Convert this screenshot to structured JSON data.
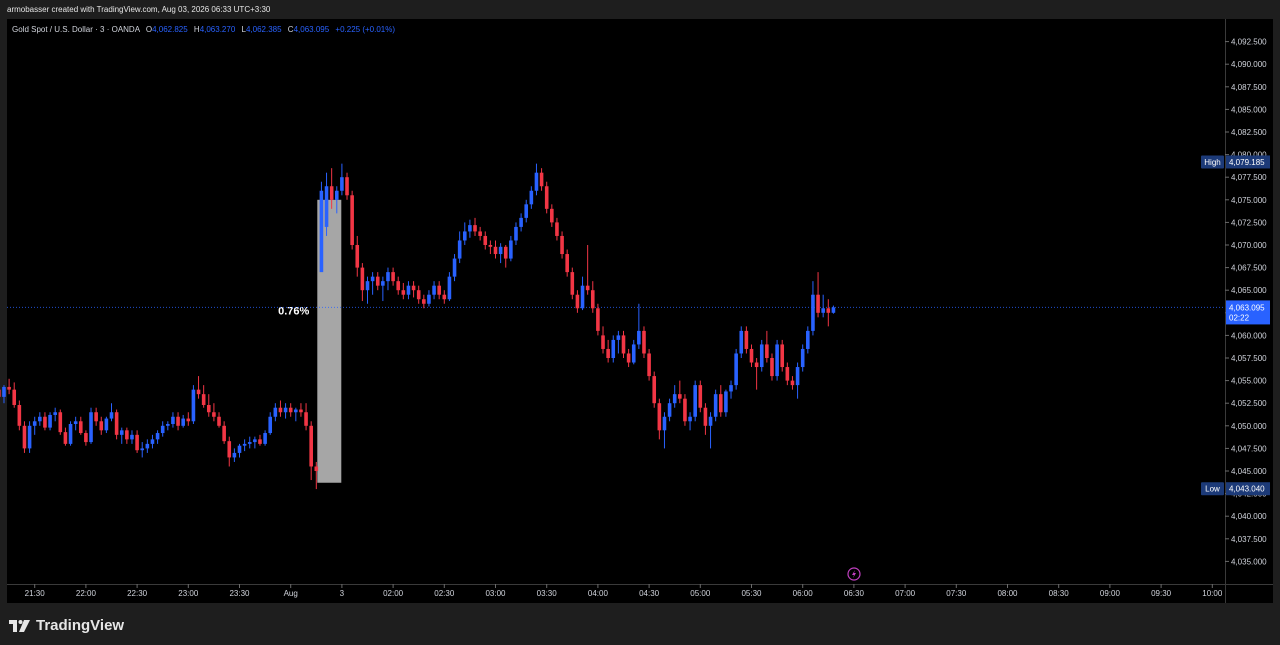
{
  "header": {
    "credit": "armobasser created with TradingView.com, Aug 03, 2026 06:33 UTC+3:30"
  },
  "legend": {
    "symbol": "Gold Spot / U.S. Dollar · 3 · OANDA",
    "o_label": "O",
    "o_value": "4,062.825",
    "h_label": "H",
    "h_value": "4,063.270",
    "l_label": "L",
    "l_value": "4,062.385",
    "c_label": "C",
    "c_value": "4,063.095",
    "change": "+0.225 (+0.01%)"
  },
  "measure": {
    "label": "0.76%"
  },
  "price_labels": {
    "high_tag": "High",
    "high_value": "4,079.185",
    "low_tag": "Low",
    "low_value": "4,043.040",
    "current_value": "4,063.095",
    "countdown": "02:22"
  },
  "footer": {
    "brand": "TradingView"
  },
  "colors": {
    "up": "#2962ff",
    "down": "#f23645",
    "background": "#000000",
    "measure_box": "#a6a6a6",
    "current_line": "#2962ff"
  },
  "icons": {
    "logo": "tradingview-logo-icon",
    "alert": "lightning-icon"
  },
  "chart_data": {
    "type": "candlestick",
    "title": "Gold Spot / U.S. Dollar · 3 · OANDA",
    "ylim": [
      4032.5,
      4095
    ],
    "y_ticks": [
      4092.5,
      4090,
      4087.5,
      4085,
      4082.5,
      4080,
      4077.5,
      4075,
      4072.5,
      4070,
      4067.5,
      4065,
      4062.5,
      4060,
      4057.5,
      4055,
      4052.5,
      4050,
      4047.5,
      4045,
      4042.5,
      4040,
      4037.5,
      4035
    ],
    "y_tick_labels": [
      "4,092.500",
      "4,090.000",
      "4,087.500",
      "4,085.000",
      "4,082.500",
      "4,080.000",
      "4,077.500",
      "4,075.000",
      "4,072.500",
      "4,070.000",
      "4,067.500",
      "4,065.000",
      "4,062.500",
      "4,060.000",
      "4,057.500",
      "4,055.000",
      "4,052.500",
      "4,050.000",
      "4,047.500",
      "4,045.000",
      "4,042.500",
      "4,040.000",
      "4,037.500",
      "4,035.000"
    ],
    "x_tick_labels": [
      "21:30",
      "22:00",
      "22:30",
      "23:00",
      "23:30",
      "Aug",
      "3",
      "02:00",
      "02:30",
      "03:00",
      "03:30",
      "04:00",
      "04:30",
      "05:00",
      "05:30",
      "06:00",
      "06:30",
      "07:00",
      "07:30",
      "08:00",
      "08:30",
      "09:00",
      "09:30",
      "10:00"
    ],
    "x_tick_index": [
      10,
      20,
      30,
      40,
      50,
      60,
      70,
      80,
      90,
      100,
      110,
      120,
      130,
      140,
      150,
      160,
      170,
      180,
      190,
      200,
      210,
      220,
      230,
      240
    ],
    "measure_range": {
      "from": 4043.7,
      "to": 4075
    },
    "current_price": 4063.095,
    "high": 4079.185,
    "low": 4043.04,
    "candles": [
      [
        4052.5,
        4054.0,
        4050.5,
        4053.5
      ],
      [
        4053.5,
        4055.0,
        4052.5,
        4054.5
      ],
      [
        4054.5,
        4055.2,
        4053.0,
        4054.0
      ],
      [
        4054.0,
        4055.0,
        4052.8,
        4053.2
      ],
      [
        4053.2,
        4054.5,
        4052.5,
        4054.3
      ],
      [
        4054.3,
        4055.2,
        4053.5,
        4054.0
      ],
      [
        4054.0,
        4054.8,
        4052.0,
        4052.3
      ],
      [
        4052.3,
        4052.8,
        4049.5,
        4050.0
      ],
      [
        4050.0,
        4050.5,
        4047.0,
        4047.5
      ],
      [
        4047.5,
        4050.5,
        4047.0,
        4050.0
      ],
      [
        4050.0,
        4051.0,
        4049.0,
        4050.5
      ],
      [
        4050.5,
        4051.5,
        4050.0,
        4051.0
      ],
      [
        4051.0,
        4051.5,
        4049.5,
        4049.8
      ],
      [
        4049.8,
        4051.5,
        4049.5,
        4051.2
      ],
      [
        4051.2,
        4052.0,
        4050.5,
        4051.5
      ],
      [
        4051.5,
        4051.8,
        4049.0,
        4049.3
      ],
      [
        4049.3,
        4049.8,
        4047.8,
        4048.0
      ],
      [
        4048.0,
        4050.5,
        4047.8,
        4050.2
      ],
      [
        4050.2,
        4051.0,
        4049.5,
        4050.5
      ],
      [
        4050.5,
        4051.0,
        4049.0,
        4049.2
      ],
      [
        4049.2,
        4049.5,
        4047.8,
        4048.2
      ],
      [
        4048.2,
        4052.0,
        4048.0,
        4051.5
      ],
      [
        4051.5,
        4052.0,
        4050.0,
        4050.5
      ],
      [
        4050.5,
        4051.0,
        4049.0,
        4049.5
      ],
      [
        4049.5,
        4051.0,
        4049.2,
        4050.8
      ],
      [
        4050.8,
        4052.5,
        4050.5,
        4051.5
      ],
      [
        4051.5,
        4051.8,
        4048.5,
        4049.0
      ],
      [
        4049.0,
        4049.8,
        4048.0,
        4049.5
      ],
      [
        4049.5,
        4049.8,
        4048.0,
        4048.5
      ],
      [
        4048.5,
        4049.5,
        4048.0,
        4049.0
      ],
      [
        4049.0,
        4049.5,
        4047.0,
        4047.3
      ],
      [
        4047.3,
        4048.2,
        4046.5,
        4047.5
      ],
      [
        4047.5,
        4048.5,
        4047.0,
        4048.0
      ],
      [
        4048.0,
        4049.0,
        4047.5,
        4048.5
      ],
      [
        4048.5,
        4049.5,
        4048.0,
        4049.2
      ],
      [
        4049.2,
        4050.5,
        4048.8,
        4050.0
      ],
      [
        4050.0,
        4050.5,
        4049.5,
        4050.2
      ],
      [
        4050.2,
        4051.5,
        4049.8,
        4051.0
      ],
      [
        4051.0,
        4051.5,
        4049.5,
        4050.0
      ],
      [
        4050.0,
        4051.2,
        4049.8,
        4050.8
      ],
      [
        4050.8,
        4051.5,
        4050.0,
        4050.5
      ],
      [
        4050.5,
        4054.5,
        4050.2,
        4054.0
      ],
      [
        4054.0,
        4055.5,
        4053.0,
        4053.5
      ],
      [
        4053.5,
        4054.5,
        4052.0,
        4052.3
      ],
      [
        4052.3,
        4053.5,
        4051.0,
        4051.5
      ],
      [
        4051.5,
        4052.5,
        4050.5,
        4051.0
      ],
      [
        4051.0,
        4051.5,
        4049.8,
        4050.0
      ],
      [
        4050.0,
        4050.5,
        4048.0,
        4048.3
      ],
      [
        4048.3,
        4048.8,
        4045.5,
        4046.5
      ],
      [
        4046.5,
        4047.5,
        4046.0,
        4047.0
      ],
      [
        4047.0,
        4048.0,
        4046.5,
        4047.8
      ],
      [
        4047.8,
        4048.5,
        4047.2,
        4048.0
      ],
      [
        4048.0,
        4048.8,
        4047.5,
        4048.2
      ],
      [
        4048.2,
        4048.8,
        4047.5,
        4048.5
      ],
      [
        4048.5,
        4049.0,
        4047.8,
        4048.0
      ],
      [
        4048.0,
        4049.5,
        4047.8,
        4049.2
      ],
      [
        4049.2,
        4051.5,
        4049.0,
        4051.0
      ],
      [
        4051.0,
        4052.5,
        4050.5,
        4052.0
      ],
      [
        4052.0,
        4052.8,
        4051.0,
        4051.5
      ],
      [
        4051.5,
        4052.5,
        4050.8,
        4052.0
      ],
      [
        4052.0,
        4052.5,
        4051.0,
        4051.5
      ],
      [
        4051.5,
        4052.0,
        4050.5,
        4051.8
      ],
      [
        4051.8,
        4052.5,
        4051.0,
        4051.5
      ],
      [
        4051.5,
        4052.5,
        4049.5,
        4050.0
      ],
      [
        4050.0,
        4050.5,
        4044.0,
        4045.5
      ],
      [
        4045.5,
        4046.0,
        4043.0,
        4045.0
      ],
      [
        4067.0,
        4077.0,
        4074.0,
        4076.0
      ],
      [
        4072.0,
        4078.0,
        4071.0,
        4076.5
      ],
      [
        4076.5,
        4078.5,
        4074.0,
        4075.0
      ],
      [
        4075.0,
        4076.5,
        4073.5,
        4076.0
      ],
      [
        4076.0,
        4079.0,
        4075.5,
        4077.5
      ],
      [
        4077.5,
        4078.0,
        4075.0,
        4075.5
      ],
      [
        4075.5,
        4076.0,
        4069.5,
        4070.0
      ],
      [
        4070.0,
        4071.0,
        4066.5,
        4067.5
      ],
      [
        4067.5,
        4068.0,
        4063.8,
        4065.0
      ],
      [
        4065.0,
        4066.5,
        4063.5,
        4066.0
      ],
      [
        4066.0,
        4067.0,
        4064.5,
        4066.5
      ],
      [
        4066.5,
        4067.0,
        4065.0,
        4065.5
      ],
      [
        4065.5,
        4066.5,
        4063.8,
        4066.0
      ],
      [
        4066.0,
        4067.5,
        4065.0,
        4067.0
      ],
      [
        4067.0,
        4067.5,
        4065.5,
        4066.0
      ],
      [
        4066.0,
        4066.5,
        4064.5,
        4065.0
      ],
      [
        4065.0,
        4065.8,
        4064.0,
        4064.5
      ],
      [
        4064.5,
        4066.0,
        4064.0,
        4065.5
      ],
      [
        4065.5,
        4066.0,
        4064.2,
        4065.0
      ],
      [
        4065.0,
        4065.5,
        4063.5,
        4064.0
      ],
      [
        4064.0,
        4064.5,
        4063.0,
        4063.5
      ],
      [
        4063.5,
        4065.0,
        4063.2,
        4064.5
      ],
      [
        4064.5,
        4066.0,
        4064.0,
        4065.5
      ],
      [
        4065.5,
        4066.0,
        4064.0,
        4064.5
      ],
      [
        4064.5,
        4065.0,
        4063.5,
        4064.0
      ],
      [
        4064.0,
        4067.0,
        4063.8,
        4066.5
      ],
      [
        4066.5,
        4069.0,
        4066.0,
        4068.5
      ],
      [
        4068.5,
        4071.5,
        4068.0,
        4070.5
      ],
      [
        4070.5,
        4072.5,
        4070.0,
        4071.5
      ],
      [
        4071.5,
        4072.8,
        4070.8,
        4072.2
      ],
      [
        4072.2,
        4073.0,
        4071.0,
        4071.5
      ],
      [
        4071.5,
        4072.0,
        4070.5,
        4071.0
      ],
      [
        4071.0,
        4071.5,
        4069.5,
        4070.0
      ],
      [
        4070.0,
        4070.5,
        4069.0,
        4069.8
      ],
      [
        4069.8,
        4070.5,
        4068.5,
        4069.0
      ],
      [
        4069.0,
        4070.2,
        4068.0,
        4069.8
      ],
      [
        4069.8,
        4070.0,
        4067.5,
        4068.5
      ],
      [
        4068.5,
        4071.0,
        4068.2,
        4070.5
      ],
      [
        4070.5,
        4072.5,
        4070.0,
        4072.0
      ],
      [
        4072.0,
        4073.5,
        4071.5,
        4073.0
      ],
      [
        4073.0,
        4075.0,
        4072.5,
        4074.5
      ],
      [
        4074.5,
        4076.5,
        4074.0,
        4076.0
      ],
      [
        4076.0,
        4079.0,
        4075.5,
        4078.0
      ],
      [
        4078.0,
        4078.5,
        4076.0,
        4076.5
      ],
      [
        4076.5,
        4077.0,
        4073.5,
        4074.0
      ],
      [
        4074.0,
        4074.5,
        4072.0,
        4072.5
      ],
      [
        4072.5,
        4073.0,
        4070.5,
        4071.0
      ],
      [
        4071.0,
        4071.5,
        4068.5,
        4069.0
      ],
      [
        4069.0,
        4069.5,
        4066.5,
        4067.0
      ],
      [
        4067.0,
        4067.5,
        4064.0,
        4064.5
      ],
      [
        4064.5,
        4065.0,
        4062.5,
        4063.0
      ],
      [
        4063.0,
        4066.5,
        4062.8,
        4065.5
      ],
      [
        4065.5,
        4070.0,
        4064.5,
        4065.0
      ],
      [
        4065.0,
        4066.0,
        4062.5,
        4063.0
      ],
      [
        4063.0,
        4063.5,
        4060.0,
        4060.5
      ],
      [
        4060.0,
        4061.0,
        4058.0,
        4058.5
      ],
      [
        4058.5,
        4059.5,
        4057.0,
        4057.5
      ],
      [
        4057.5,
        4060.0,
        4057.0,
        4059.5
      ],
      [
        4059.5,
        4060.5,
        4058.0,
        4060.0
      ],
      [
        4060.0,
        4060.5,
        4057.5,
        4058.0
      ],
      [
        4058.0,
        4058.5,
        4056.5,
        4057.0
      ],
      [
        4057.0,
        4059.5,
        4056.8,
        4059.0
      ],
      [
        4059.0,
        4063.5,
        4058.5,
        4060.5
      ],
      [
        4060.5,
        4061.0,
        4057.5,
        4058.0
      ],
      [
        4058.0,
        4058.5,
        4055.0,
        4055.5
      ],
      [
        4055.5,
        4056.0,
        4052.0,
        4052.5
      ],
      [
        4052.5,
        4053.0,
        4048.5,
        4049.5
      ],
      [
        4049.5,
        4051.5,
        4047.5,
        4051.0
      ],
      [
        4051.0,
        4053.0,
        4050.5,
        4052.5
      ],
      [
        4052.5,
        4054.5,
        4052.0,
        4053.5
      ],
      [
        4053.5,
        4055.0,
        4052.5,
        4053.0
      ],
      [
        4053.0,
        4053.5,
        4050.0,
        4050.5
      ],
      [
        4050.5,
        4051.5,
        4049.5,
        4051.0
      ],
      [
        4051.0,
        4055.0,
        4050.5,
        4054.5
      ],
      [
        4054.5,
        4055.0,
        4051.5,
        4052.0
      ],
      [
        4052.0,
        4052.5,
        4049.0,
        4050.0
      ],
      [
        4050.0,
        4051.5,
        4047.5,
        4051.0
      ],
      [
        4051.0,
        4054.0,
        4050.5,
        4053.5
      ],
      [
        4053.5,
        4054.5,
        4051.0,
        4051.5
      ],
      [
        4051.5,
        4054.0,
        4051.0,
        4053.8
      ],
      [
        4053.8,
        4055.0,
        4053.0,
        4054.5
      ],
      [
        4054.5,
        4058.5,
        4054.0,
        4058.0
      ],
      [
        4058.0,
        4061.0,
        4057.5,
        4060.5
      ],
      [
        4060.5,
        4061.0,
        4058.0,
        4058.5
      ],
      [
        4058.5,
        4059.0,
        4056.5,
        4057.0
      ],
      [
        4057.0,
        4057.5,
        4054.0,
        4056.5
      ],
      [
        4056.5,
        4059.5,
        4056.0,
        4059.0
      ],
      [
        4059.0,
        4060.5,
        4057.0,
        4057.5
      ],
      [
        4057.5,
        4058.0,
        4055.0,
        4055.5
      ],
      [
        4055.5,
        4059.5,
        4055.0,
        4059.0
      ],
      [
        4059.0,
        4059.5,
        4056.0,
        4056.5
      ],
      [
        4056.5,
        4057.0,
        4054.5,
        4055.0
      ],
      [
        4055.0,
        4055.5,
        4054.0,
        4054.5
      ],
      [
        4054.5,
        4057.0,
        4053.0,
        4056.5
      ],
      [
        4056.5,
        4059.0,
        4056.0,
        4058.5
      ],
      [
        4058.5,
        4061.0,
        4058.0,
        4060.5
      ],
      [
        4060.5,
        4066.0,
        4060.0,
        4064.5
      ],
      [
        4064.5,
        4067.0,
        4062.0,
        4062.5
      ],
      [
        4062.5,
        4064.5,
        4062.0,
        4063.0
      ],
      [
        4063.0,
        4064.0,
        4061.0,
        4062.5
      ],
      [
        4062.5,
        4063.3,
        4062.4,
        4063.1
      ]
    ]
  }
}
